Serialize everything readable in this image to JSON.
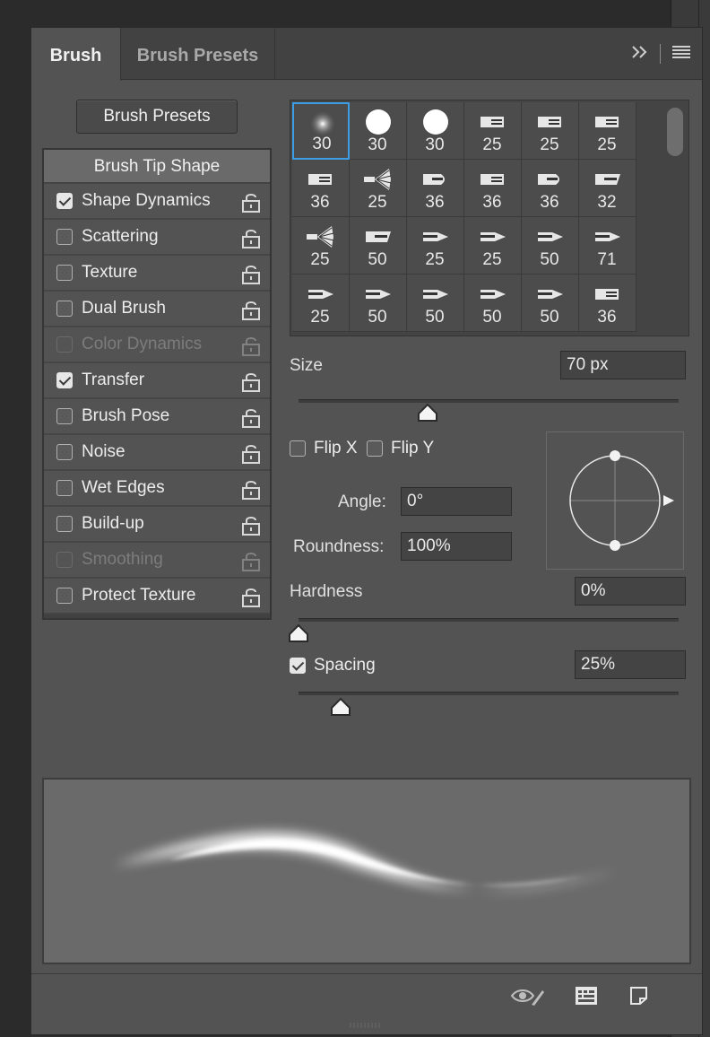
{
  "tabs": [
    {
      "label": "Brush",
      "active": true
    },
    {
      "label": "Brush Presets",
      "active": false
    }
  ],
  "header_icons": [
    "expand-icon",
    "menu-icon"
  ],
  "presets_button": "Brush Presets",
  "options_header": "Brush Tip Shape",
  "options": [
    {
      "label": "Shape Dynamics",
      "checked": true,
      "enabled": true
    },
    {
      "label": "Scattering",
      "checked": false,
      "enabled": true
    },
    {
      "label": "Texture",
      "checked": false,
      "enabled": true
    },
    {
      "label": "Dual Brush",
      "checked": false,
      "enabled": true
    },
    {
      "label": "Color Dynamics",
      "checked": false,
      "enabled": false
    },
    {
      "label": "Transfer",
      "checked": true,
      "enabled": true
    },
    {
      "label": "Brush Pose",
      "checked": false,
      "enabled": true
    },
    {
      "label": "Noise",
      "checked": false,
      "enabled": true
    },
    {
      "label": "Wet Edges",
      "checked": false,
      "enabled": true
    },
    {
      "label": "Build-up",
      "checked": false,
      "enabled": true
    },
    {
      "label": "Smoothing",
      "checked": false,
      "enabled": false
    },
    {
      "label": "Protect Texture",
      "checked": false,
      "enabled": true
    }
  ],
  "brush_tips": [
    {
      "size": "30",
      "shape": "soft-round",
      "selected": true
    },
    {
      "size": "30",
      "shape": "hard-round"
    },
    {
      "size": "30",
      "shape": "hard-round"
    },
    {
      "size": "25",
      "shape": "bristle-a"
    },
    {
      "size": "25",
      "shape": "flat-a"
    },
    {
      "size": "25",
      "shape": "flat-b"
    },
    {
      "size": "36",
      "shape": "fan-flat"
    },
    {
      "size": "25",
      "shape": "fan"
    },
    {
      "size": "36",
      "shape": "round-tip"
    },
    {
      "size": "36",
      "shape": "flat-c"
    },
    {
      "size": "36",
      "shape": "round-tip"
    },
    {
      "size": "32",
      "shape": "angled"
    },
    {
      "size": "25",
      "shape": "fan-round"
    },
    {
      "size": "50",
      "shape": "angled"
    },
    {
      "size": "25",
      "shape": "pencil"
    },
    {
      "size": "25",
      "shape": "pencil"
    },
    {
      "size": "50",
      "shape": "pencil-b"
    },
    {
      "size": "71",
      "shape": "pencil-b"
    },
    {
      "size": "25",
      "shape": "pencil-b"
    },
    {
      "size": "50",
      "shape": "pencil-b"
    },
    {
      "size": "50",
      "shape": "pencil-b"
    },
    {
      "size": "50",
      "shape": "pencil-b"
    },
    {
      "size": "50",
      "shape": "pencil-b"
    },
    {
      "size": "36",
      "shape": "flat-c"
    }
  ],
  "size": {
    "label": "Size",
    "value": "70 px",
    "slider_fraction": 0.34
  },
  "flip_x": {
    "label": "Flip X",
    "checked": false
  },
  "flip_y": {
    "label": "Flip Y",
    "checked": false
  },
  "angle": {
    "label": "Angle:",
    "value": "0°"
  },
  "roundness": {
    "label": "Roundness:",
    "value": "100%"
  },
  "hardness": {
    "label": "Hardness",
    "value": "0%",
    "slider_fraction": 0.0
  },
  "spacing": {
    "label": "Spacing",
    "checked": true,
    "value": "25%",
    "slider_fraction": 0.11
  },
  "bottom_icons": [
    "eye-brush-icon",
    "grid-panel-icon",
    "new-preset-icon"
  ],
  "colors": {
    "selection": "#3d9ee6",
    "panel": "#535353",
    "background": "#2b2b2b"
  }
}
